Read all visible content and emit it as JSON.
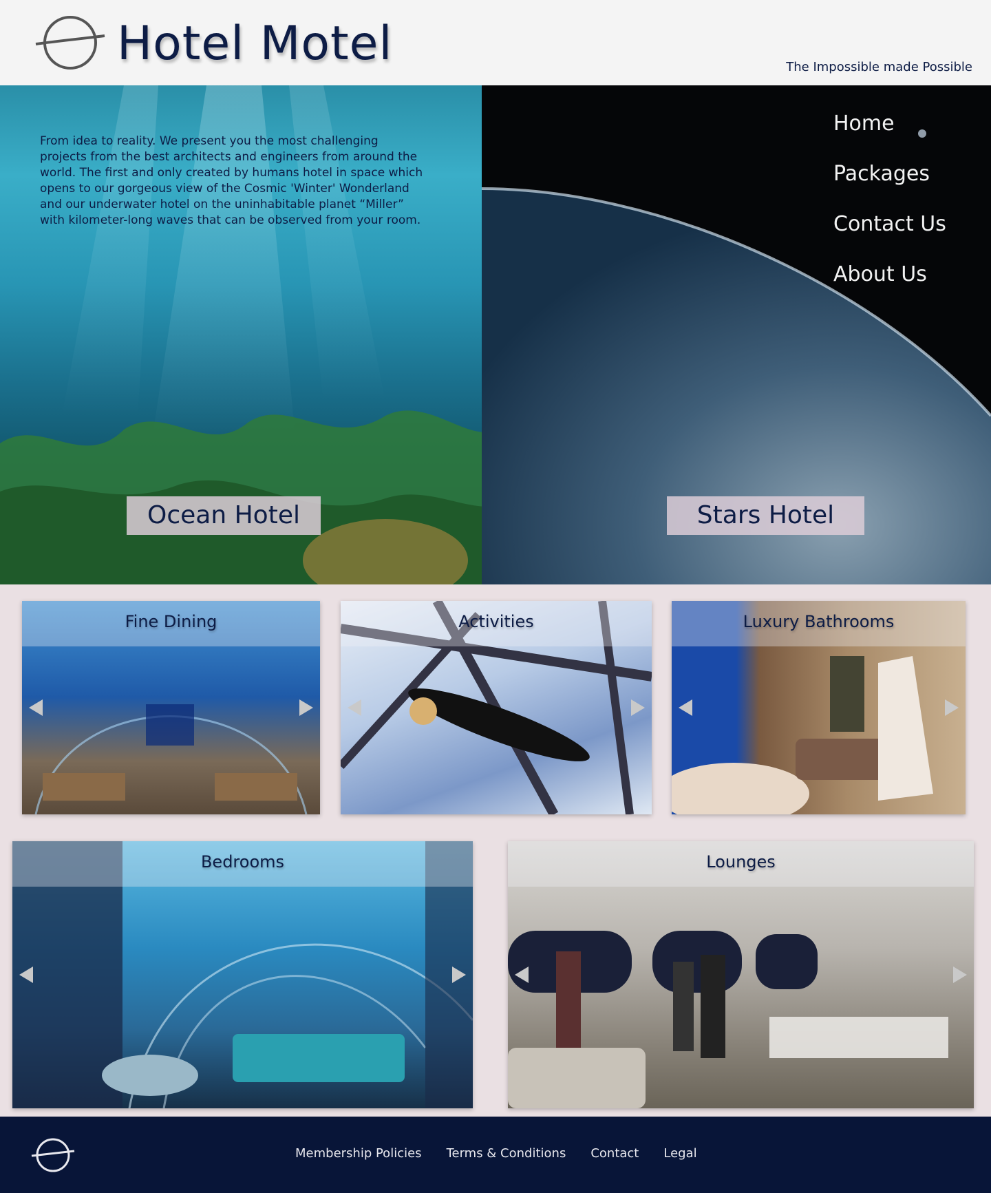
{
  "header": {
    "brand": "Hotel Motel",
    "tagline": "The Impossible made Possible",
    "logo_icon": "orbit-logo-icon"
  },
  "hero": {
    "description": "From idea to reality. We present you the most challenging projects from the best architects and engineers from around the world. The first and only created by humans hotel in space which opens to our gorgeous view of the Cosmic 'Winter' Wonderland and our underwater hotel on the uninhabitable planet “Miller” with kilometer-long waves that can be observed from your room.",
    "ocean_label": "Ocean Hotel",
    "stars_label": "Stars Hotel"
  },
  "nav": {
    "items": [
      {
        "label": "Home"
      },
      {
        "label": "Packages"
      },
      {
        "label": "Contact Us"
      },
      {
        "label": "About Us"
      }
    ]
  },
  "gallery": {
    "cards": [
      {
        "title": "Fine Dining"
      },
      {
        "title": "Activities"
      },
      {
        "title": "Luxury Bathrooms"
      },
      {
        "title": "Bedrooms"
      },
      {
        "title": "Lounges"
      }
    ],
    "prev_icon": "triangle-left-icon",
    "next_icon": "triangle-right-icon"
  },
  "footer": {
    "links": [
      {
        "label": "Membership Policies"
      },
      {
        "label": "Terms & Conditions"
      },
      {
        "label": "Contact"
      },
      {
        "label": "Legal"
      }
    ]
  },
  "colors": {
    "navy": "#0d1c45",
    "footer_bg": "#081538",
    "page_bg": "#eae0e3",
    "header_bg": "#f4f4f4"
  }
}
